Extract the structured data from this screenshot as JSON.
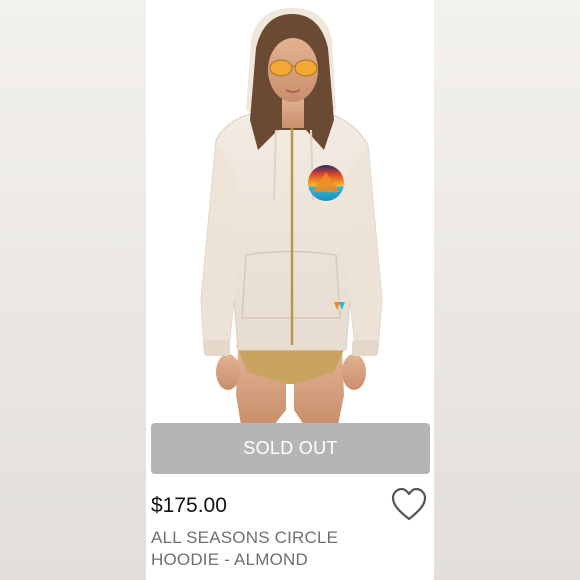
{
  "product": {
    "status_button_label": "SOLD OUT",
    "price": "$175.00",
    "title": "ALL SEASONS CIRCLE HOODIE - ALMOND"
  },
  "icons": {
    "favorite": "heart-outline-icon"
  },
  "colors": {
    "button_background": "#b5b5b5",
    "button_text": "#ffffff",
    "price_text": "#111111",
    "title_text": "#6f6f6f",
    "hoodie": "#efe6dc",
    "logo_blue": "#2fb6d8",
    "logo_orange": "#f08a24"
  }
}
